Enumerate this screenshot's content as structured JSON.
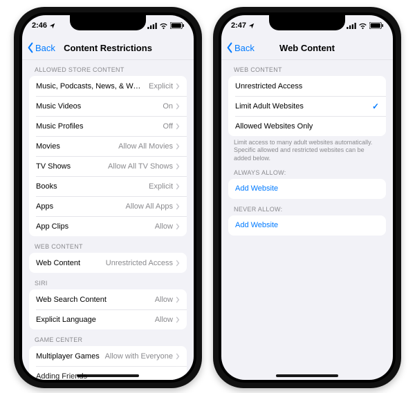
{
  "left": {
    "status_time": "2:46",
    "back_label": "Back",
    "title": "Content Restrictions",
    "sections": [
      {
        "header": "ALLOWED STORE CONTENT",
        "rows": [
          {
            "name": "row-music-podcasts",
            "label": "Music, Podcasts, News, & Workouts",
            "value": "Explicit",
            "chevron": true
          },
          {
            "name": "row-music-videos",
            "label": "Music Videos",
            "value": "On",
            "chevron": true
          },
          {
            "name": "row-music-profiles",
            "label": "Music Profiles",
            "value": "Off",
            "chevron": true
          },
          {
            "name": "row-movies",
            "label": "Movies",
            "value": "Allow All Movies",
            "chevron": true
          },
          {
            "name": "row-tv-shows",
            "label": "TV Shows",
            "value": "Allow All TV Shows",
            "chevron": true
          },
          {
            "name": "row-books",
            "label": "Books",
            "value": "Explicit",
            "chevron": true
          },
          {
            "name": "row-apps",
            "label": "Apps",
            "value": "Allow All Apps",
            "chevron": true
          },
          {
            "name": "row-app-clips",
            "label": "App Clips",
            "value": "Allow",
            "chevron": true
          }
        ]
      },
      {
        "header": "WEB CONTENT",
        "rows": [
          {
            "name": "row-web-content",
            "label": "Web Content",
            "value": "Unrestricted Access",
            "chevron": true
          }
        ]
      },
      {
        "header": "SIRI",
        "rows": [
          {
            "name": "row-web-search",
            "label": "Web Search Content",
            "value": "Allow",
            "chevron": true
          },
          {
            "name": "row-explicit-language",
            "label": "Explicit Language",
            "value": "Allow",
            "chevron": true
          }
        ]
      },
      {
        "header": "GAME CENTER",
        "rows": [
          {
            "name": "row-multiplayer",
            "label": "Multiplayer Games",
            "value": "Allow with Everyone",
            "chevron": true,
            "peek": false
          },
          {
            "name": "row-adding-friends",
            "label": "Adding Friends",
            "value": "",
            "chevron": false,
            "peek": true
          }
        ]
      }
    ]
  },
  "right": {
    "status_time": "2:47",
    "back_label": "Back",
    "title": "Web Content",
    "web_header": "WEB CONTENT",
    "options": [
      {
        "name": "option-unrestricted",
        "label": "Unrestricted Access",
        "selected": false
      },
      {
        "name": "option-limit-adult",
        "label": "Limit Adult Websites",
        "selected": true
      },
      {
        "name": "option-allowed-only",
        "label": "Allowed Websites Only",
        "selected": false
      }
    ],
    "footer_note": "Limit access to many adult websites automatically. Specific allowed and restricted websites can be added below.",
    "always_header": "ALWAYS ALLOW:",
    "always_add": "Add Website",
    "never_header": "NEVER ALLOW:",
    "never_add": "Add Website"
  }
}
